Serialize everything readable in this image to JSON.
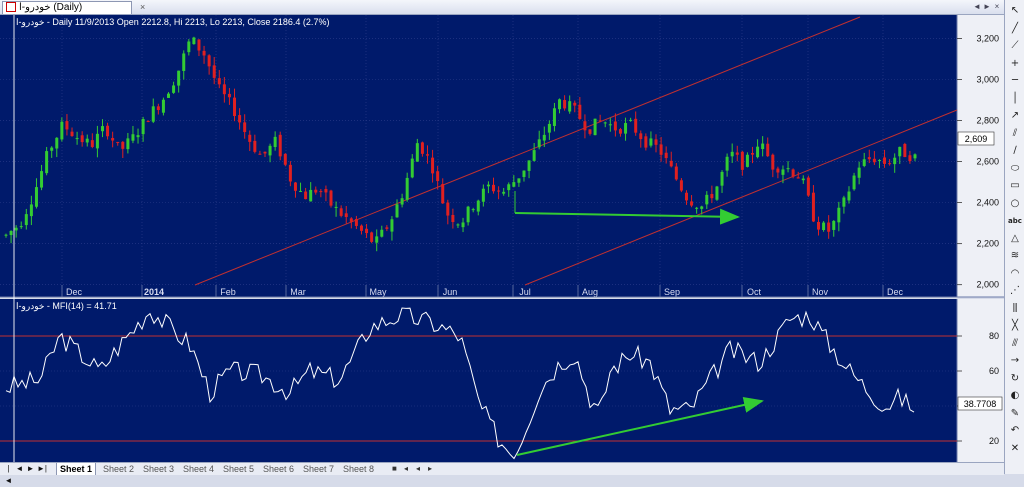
{
  "window": {
    "tab_title": "خودرو-ا (Daily)",
    "tab_close": "×",
    "nav_left": "◄",
    "nav_right": "►",
    "nav_close": "×"
  },
  "toolbar_icons": [
    "pointer-icon",
    "line-icon",
    "ray-icon",
    "crosshair-icon",
    "horizontal-line-icon",
    "vertical-line-icon",
    "trend-icon",
    "channel-icon",
    "regression-icon",
    "ellipse-icon",
    "rectangle-icon",
    "circle-icon",
    "text-icon",
    "triangle-icon",
    "fibonacci-icon",
    "arc-icon",
    "fan-icon",
    "cycles-icon",
    "gann-icon",
    "andrews-icon",
    "arrow-icon",
    "refresh-icon",
    "color-icon",
    "draw-icon",
    "undo-icon",
    "delete-icon"
  ],
  "chart_data": [
    {
      "type": "candlestick",
      "title": "خودرو-ا - Daily 11/9/2013 Open 2212.8, Hi 2213, Lo 2213, Close 2186.4 (2.7%)",
      "ylim": [
        1940,
        3290
      ],
      "yticks": [
        2000,
        2200,
        2400,
        2600,
        2800,
        3000,
        3200
      ],
      "ytick_labels": [
        "2,000",
        "2,200",
        "2,400",
        "2,600",
        "2,800",
        "3,000",
        "3,200"
      ],
      "last_value_label": "2,609",
      "last_value": 2609,
      "x_month_labels": [
        "Dec",
        "2014",
        "Feb",
        "Mar",
        "May",
        "Jun",
        "Jul",
        "Aug",
        "Sep",
        "Oct",
        "Nov",
        "Dec"
      ],
      "bars_count": 180,
      "price_path": [
        [
          0,
          2240
        ],
        [
          4,
          2300
        ],
        [
          8,
          2450
        ],
        [
          12,
          2650
        ],
        [
          16,
          2780
        ],
        [
          20,
          2720
        ],
        [
          24,
          2680
        ],
        [
          28,
          2770
        ],
        [
          32,
          2650
        ],
        [
          36,
          2720
        ],
        [
          40,
          2820
        ],
        [
          44,
          2900
        ],
        [
          48,
          3020
        ],
        [
          52,
          3200
        ],
        [
          56,
          3120
        ],
        [
          60,
          2950
        ],
        [
          64,
          2860
        ],
        [
          68,
          2720
        ],
        [
          72,
          2620
        ],
        [
          76,
          2700
        ],
        [
          80,
          2520
        ],
        [
          84,
          2430
        ],
        [
          88,
          2470
        ],
        [
          92,
          2380
        ],
        [
          96,
          2320
        ],
        [
          100,
          2260
        ],
        [
          104,
          2200
        ],
        [
          108,
          2300
        ],
        [
          112,
          2460
        ],
        [
          116,
          2700
        ],
        [
          120,
          2580
        ],
        [
          124,
          2350
        ],
        [
          128,
          2300
        ],
        [
          132,
          2400
        ],
        [
          136,
          2480
        ],
        [
          140,
          2450
        ],
        [
          144,
          2520
        ],
        [
          148,
          2620
        ],
        [
          152,
          2750
        ],
        [
          156,
          2900
        ],
        [
          160,
          2850
        ],
        [
          164,
          2760
        ],
        [
          168,
          2800
        ],
        [
          172,
          2760
        ],
        [
          176,
          2780
        ],
        [
          180,
          2700
        ],
        [
          184,
          2660
        ],
        [
          188,
          2540
        ],
        [
          192,
          2420
        ],
        [
          196,
          2380
        ],
        [
          200,
          2470
        ],
        [
          204,
          2640
        ],
        [
          208,
          2580
        ],
        [
          212,
          2700
        ],
        [
          216,
          2580
        ],
        [
          220,
          2570
        ],
        [
          224,
          2520
        ],
        [
          228,
          2300
        ],
        [
          232,
          2260
        ],
        [
          236,
          2400
        ],
        [
          240,
          2580
        ],
        [
          244,
          2620
        ],
        [
          248,
          2590
        ],
        [
          252,
          2650
        ],
        [
          256,
          2620
        ]
      ],
      "channel_lines_color": "#c03030",
      "arrow_color": "#33cc33"
    },
    {
      "type": "line",
      "title": "خودرو-ا - MFI(14) = 41.71",
      "series": [
        {
          "name": "MFI(14)",
          "color": "#ffffff"
        }
      ],
      "ylim": [
        8,
        100
      ],
      "yticks": [
        20,
        40,
        60,
        80
      ],
      "ytick_labels": [
        "20",
        "40",
        "60",
        "80"
      ],
      "reference_lines": [
        80,
        20
      ],
      "last_value_label": "38.7708",
      "last_value": 38.7708
    }
  ],
  "sheets": {
    "tabs": [
      "Sheet 1",
      "Sheet 2",
      "Sheet 3",
      "Sheet 4",
      "Sheet 5",
      "Sheet 6",
      "Sheet 7",
      "Sheet 8"
    ],
    "active": "Sheet 1",
    "nav": [
      "|◄",
      "◄",
      "►",
      "►|"
    ]
  }
}
